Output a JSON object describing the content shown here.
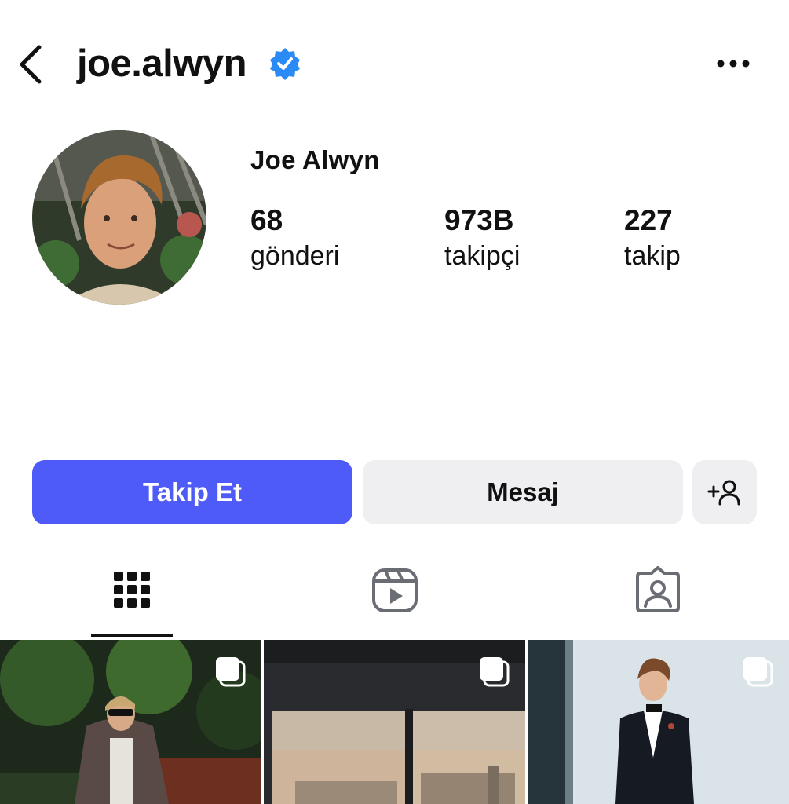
{
  "header": {
    "username": "joe.alwyn",
    "back_icon": "chevron-left-icon",
    "verified_icon": "verified-badge-icon",
    "more_icon": "more-horizontal-icon"
  },
  "profile": {
    "display_name": "Joe Alwyn",
    "stats": {
      "posts": {
        "value": "68",
        "label": "gönderi"
      },
      "followers": {
        "value": "973B",
        "label": "takipçi"
      },
      "following": {
        "value": "227",
        "label": "takip"
      }
    }
  },
  "actions": {
    "follow_label": "Takip Et",
    "message_label": "Mesaj",
    "add_user_icon": "add-user-icon"
  },
  "tabs": [
    {
      "icon": "grid-icon",
      "active": true
    },
    {
      "icon": "reels-icon",
      "active": false
    },
    {
      "icon": "tagged-icon",
      "active": false
    }
  ],
  "colors": {
    "accent": "#4f5bf8",
    "verified": "#2a8af6",
    "secondary_button": "#efeff2"
  }
}
